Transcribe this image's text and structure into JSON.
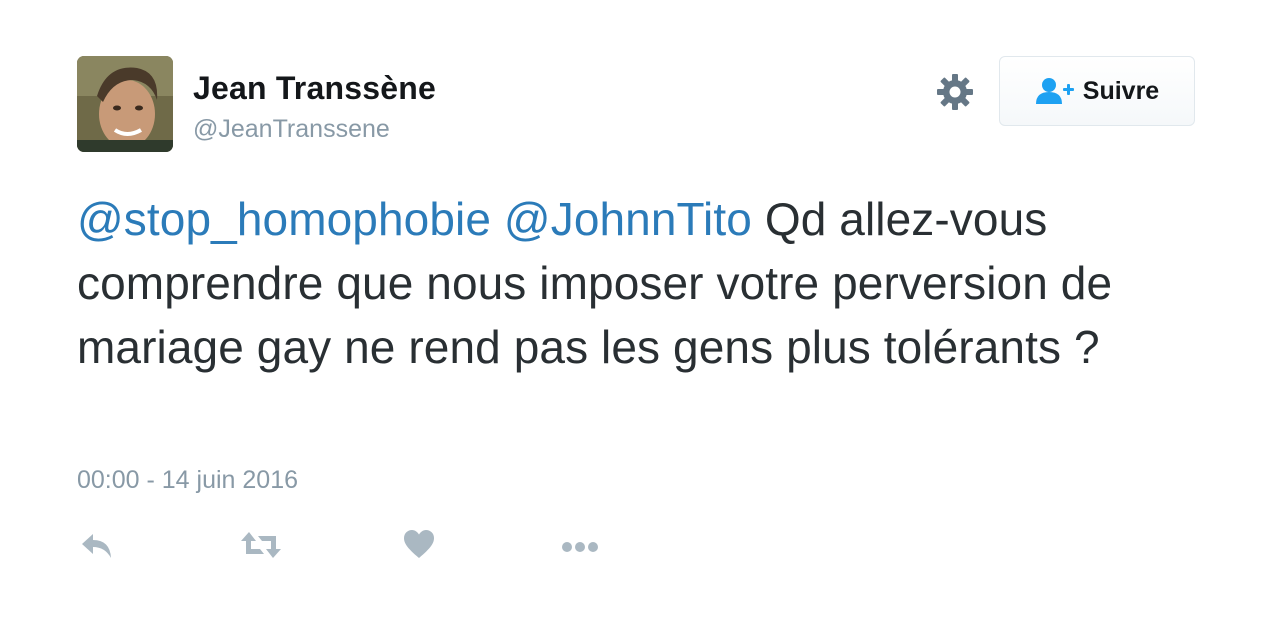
{
  "author": {
    "name": "Jean Transsène",
    "handle": "@JeanTranssene"
  },
  "follow_button": {
    "label": "Suivre"
  },
  "tweet": {
    "mention_1": "@stop_homophobie",
    "mention_2": "@JohnnTito",
    "body": " Qd allez-vous comprendre que nous imposer votre perversion de mariage gay ne rend pas les gens plus tolérants ?"
  },
  "timestamp": "00:00 - 14 juin 2016",
  "icons": {
    "settings": "gear-icon",
    "follow": "add-user-icon",
    "reply": "reply-icon",
    "retweet": "retweet-icon",
    "like": "heart-icon",
    "more": "more-dots-icon"
  },
  "colors": {
    "link": "#2b7bb9",
    "muted": "#8899a6",
    "text": "#292f33",
    "follow_icon": "#1da1f2"
  }
}
